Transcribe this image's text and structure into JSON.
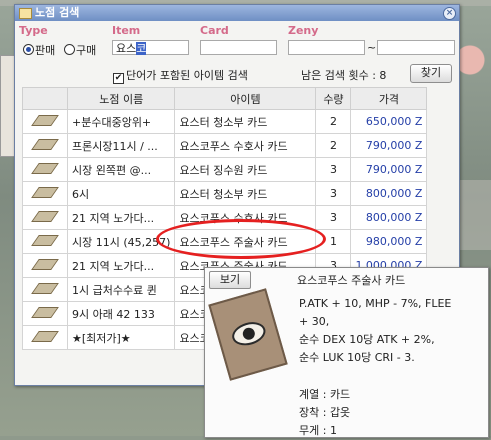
{
  "window": {
    "title": "노점 검색"
  },
  "filters": {
    "type_label": "Type",
    "item_label": "Item",
    "card_label": "Card",
    "zeny_label": "Zeny",
    "radio_sell": "판매",
    "radio_buy": "구매",
    "item_value_plain": "요스",
    "item_value_selected": "코",
    "zeny_separator": "~",
    "only_card_checkbox": "단어가 포함된 아이템 검색",
    "remaining_text": "남은 검색 횟수 : 8",
    "search_button": "찾기"
  },
  "table": {
    "headers": [
      "노점 이름",
      "아이템",
      "수량",
      "가격"
    ],
    "rows": [
      {
        "shop": "+분수대중앙위+",
        "item": "요스터 청소부 카드",
        "qty": "2",
        "price": "650,000 Z"
      },
      {
        "shop": "프론시장11시 / ...",
        "item": "요스코푸스 수호사 카드",
        "qty": "2",
        "price": "790,000 Z"
      },
      {
        "shop": "시장 왼쪽편 @...",
        "item": "요스터 징수원 카드",
        "qty": "3",
        "price": "790,000 Z"
      },
      {
        "shop": "6시",
        "item": "요스터 청소부 카드",
        "qty": "3",
        "price": "800,000 Z"
      },
      {
        "shop": "21 지역 노가다...",
        "item": "요스코푸스 수호사 카드",
        "qty": "3",
        "price": "800,000 Z"
      },
      {
        "shop": "시장 11시 (45,257)",
        "item": "요스코푸스 주술사 카드",
        "qty": "1",
        "price": "980,000 Z"
      },
      {
        "shop": "21 지역 노가다...",
        "item": "요스코푸스 주술사 카드",
        "qty": "3",
        "price": "1,000,000 Z"
      },
      {
        "shop": "1시 급처수수료 퀸",
        "item": "요스코",
        "qty": "",
        "price": ""
      },
      {
        "shop": "9시 아래 42 133",
        "item": "요스코",
        "qty": "",
        "price": ""
      },
      {
        "shop": "★[최저가]★",
        "item": "요스코",
        "qty": "",
        "price": ""
      }
    ]
  },
  "popup": {
    "view_button": "보기",
    "name": "요스코푸스 주술사 카드",
    "description": "P.ATK + 10, MHP - 7%, FLEE\n+ 30,\n순수 DEX 10당 ATK + 2%,\n순수 LUK 10당 CRI - 3.",
    "category": "계열 : 카드",
    "equip": "장착 : 갑옷",
    "weight": "무게 : 1"
  }
}
